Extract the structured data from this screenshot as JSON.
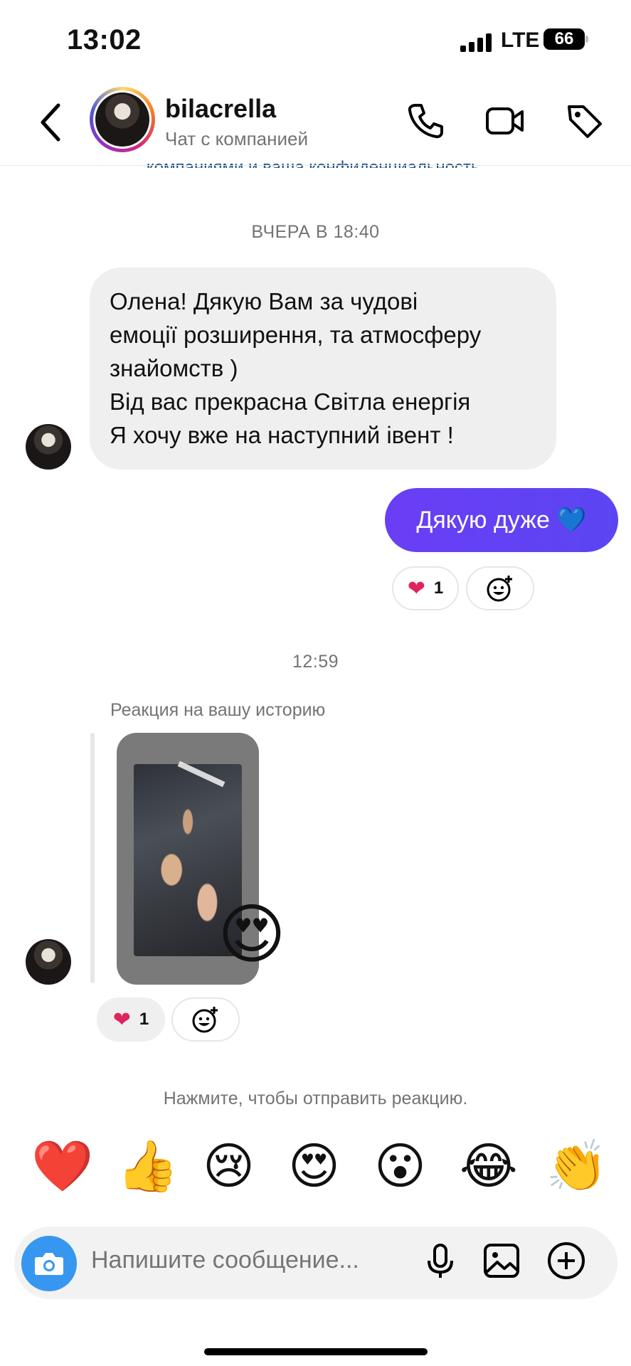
{
  "status_bar": {
    "time": "13:02",
    "network": "LTE",
    "battery": "66"
  },
  "header": {
    "username": "bilacrella",
    "subtitle": "Чат с компанией",
    "notice_fragment": "компаниями и ваша конфиденциальность."
  },
  "messages": {
    "timestamp_1": "ВЧЕРА В 18:40",
    "incoming_lines": [
      "Олена! Дякую Вам за чудові",
      "емоції розширення, та атмосферу",
      "знайомств )",
      "Від вас прекрасна Світла енергія",
      "Я хочу вже на наступний івент !"
    ],
    "outgoing_text": "Дякую дуже 💙",
    "outgoing_reaction": {
      "emoji": "❤",
      "count": "1"
    },
    "timestamp_2": "12:59",
    "story_reply_label": "Реакция на вашу историю",
    "story_emoji": "😍",
    "story_reaction": {
      "emoji": "❤",
      "count": "1"
    }
  },
  "reactions_bar": {
    "hint": "Нажмите, чтобы отправить реакцию.",
    "emojis": [
      "❤️",
      "👍",
      "😢",
      "😍",
      "😮",
      "😂",
      "👏"
    ]
  },
  "composer": {
    "placeholder": "Напишите сообщение..."
  },
  "colors": {
    "accent_blue": "#3797f0",
    "outgoing_bubble": "#5b45f2",
    "incoming_bubble": "#efefef"
  }
}
